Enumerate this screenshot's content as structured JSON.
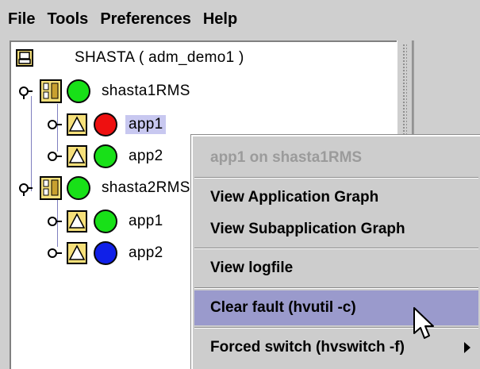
{
  "menubar": {
    "items": [
      "File",
      "Tools",
      "Preferences",
      "Help"
    ]
  },
  "tree": {
    "root_label": "SHASTA ( adm_demo1 )",
    "nodes": [
      {
        "label": "shasta1RMS",
        "status_color": "#18e018",
        "apps": [
          {
            "label": "app1",
            "status_color": "#ee1010",
            "selected": true
          },
          {
            "label": "app2",
            "status_color": "#18e018",
            "selected": false
          }
        ]
      },
      {
        "label": "shasta2RMS",
        "status_color": "#18e018",
        "apps": [
          {
            "label": "app1",
            "status_color": "#18e018",
            "selected": false
          },
          {
            "label": "app2",
            "status_color": "#1020e8",
            "selected": false
          }
        ]
      }
    ]
  },
  "context_menu": {
    "header": "app1 on shasta1RMS",
    "items": [
      "View Application Graph",
      "View Subapplication Graph",
      "View logfile",
      "Clear fault (hvutil -c)",
      "Forced switch (hvswitch -f)"
    ],
    "highlighted": "Clear fault (hvutil -c)"
  },
  "colors": {
    "background": "#cfcfcf",
    "selection": "#c8c8f0",
    "menu_highlight": "#9a9acc",
    "icon_yellow": "#f6e07a"
  }
}
